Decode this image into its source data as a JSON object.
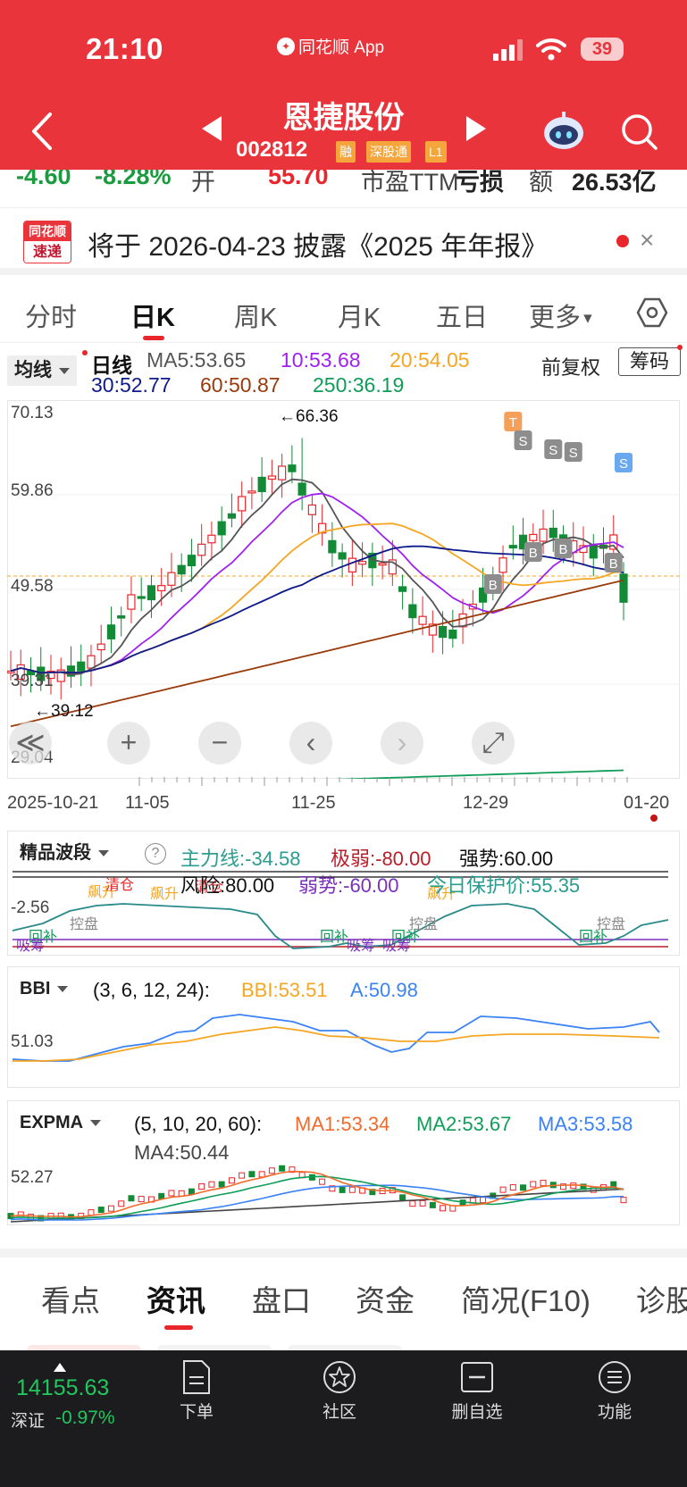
{
  "status_bar": {
    "time": "21:10",
    "app_name": "同花顺 App",
    "battery": "39"
  },
  "header": {
    "stock_name": "恩捷股份",
    "stock_code": "002812",
    "tags": [
      "融",
      "深股通",
      "L1"
    ]
  },
  "quote_strip": {
    "change": "-4.60",
    "change_pct": "-8.28%",
    "open_label": "开",
    "open_value": "55.70",
    "pe_label": "市盈TTM",
    "pe_value": "亏损",
    "amount_label": "额",
    "amount_value": "26.53亿"
  },
  "banner": {
    "logo_top": "同花顺",
    "logo_bottom": "速递",
    "text": "将于 2026-04-23 披露《2025 年年报》",
    "close": "×"
  },
  "period_tabs": [
    "分时",
    "日K",
    "周K",
    "月K",
    "五日",
    "更多"
  ],
  "kline": {
    "indicator_select": "均线",
    "ma_label": "日线",
    "ma5": "MA5:53.65",
    "ma10": "10:53.68",
    "ma20": "20:54.05",
    "ma30": "30:52.77",
    "ma60": "60:50.87",
    "ma250": "250:36.19",
    "adjust_label": "前复权",
    "chip_button": "筹码",
    "y_labels": [
      "70.13",
      "59.86",
      "49.58",
      "39.31",
      "29.04"
    ],
    "high_marker": "←66.36",
    "low_marker": "←39.12",
    "x_labels": [
      "2025-10-21",
      "11-05",
      "11-25",
      "12-29",
      "01-20"
    ],
    "signals": {
      "T": "T",
      "S": "S",
      "B": "B"
    },
    "controls": {
      "rewind": "≪",
      "zoom_in": "+",
      "zoom_out": "−",
      "prev": "‹",
      "next": "›",
      "fullscreen": "⤢"
    },
    "colors": {
      "up": "#e8262b",
      "down": "#138a36",
      "ma5": "#555555",
      "ma10": "#a020f0",
      "ma20": "#f5a623",
      "ma30": "#0d1a8a",
      "ma60": "#9a3a0a",
      "ma250": "#0f9d58"
    }
  },
  "bodong": {
    "select": "精品波段",
    "help": "?",
    "zhuli": "主力线:-34.58",
    "jiruo": "极弱:-80.00",
    "qiangshi": "强势:60.00",
    "fengxian": "风险:80.00",
    "ruoshi": "弱势:-60.00",
    "baohu": "今日保护价:55.35",
    "y_label": "-2.56",
    "annotations": [
      "飙升",
      "清仓",
      "飙升",
      "清仓",
      "飙升",
      "控盘",
      "控盘",
      "控盘",
      "回补",
      "回补",
      "回补",
      "回补",
      "吸筹",
      "吸筹",
      "吸筹"
    ]
  },
  "bbi": {
    "select": "BBI",
    "params": "(3, 6, 12, 24):",
    "bbi": "BBI:53.51",
    "a": "A:50.98",
    "y_label": "51.03"
  },
  "expma": {
    "select": "EXPMA",
    "params": "(5, 10, 20, 60):",
    "ma1": "MA1:53.34",
    "ma2": "MA2:53.67",
    "ma3": "MA3:53.58",
    "ma4": "MA4:50.44",
    "y_label": "52.27"
  },
  "info_tabs": [
    "看点",
    "资讯",
    "盘口",
    "资金",
    "简况(F10)",
    "诊股"
  ],
  "bottom_nav": {
    "index_value": "14155.63",
    "index_name": "深证",
    "index_change": "-0.97%",
    "items": [
      "下单",
      "社区",
      "删自选",
      "功能"
    ]
  }
}
